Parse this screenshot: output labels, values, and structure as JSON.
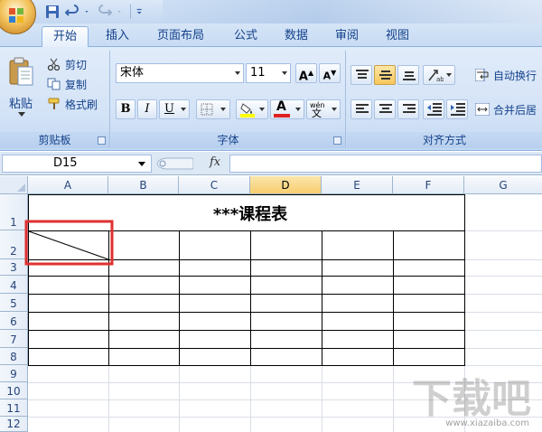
{
  "tabs": [
    "开始",
    "插入",
    "页面布局",
    "公式",
    "数据",
    "审阅",
    "视图"
  ],
  "active_tab": "开始",
  "clipboard": {
    "paste": "粘贴",
    "cut": "剪切",
    "copy": "复制",
    "format_painter": "格式刷",
    "group_label": "剪贴板"
  },
  "font": {
    "name": "宋体",
    "size": "11",
    "grow": "A",
    "shrink": "A",
    "bold": "B",
    "italic": "I",
    "underline": "U",
    "color_letter": "A",
    "pinyin": "wén",
    "pinyin_char": "文",
    "group_label": "字体"
  },
  "alignment": {
    "wrap_text": "自动换行",
    "merge_center": "合并后居",
    "group_label": "对齐方式"
  },
  "formula_bar": {
    "name_box": "D15",
    "fx": "fx",
    "value": ""
  },
  "columns": [
    "A",
    "B",
    "C",
    "D",
    "E",
    "F",
    "G"
  ],
  "selected_column": "D",
  "rows": [
    "1",
    "2",
    "3",
    "4",
    "5",
    "6",
    "7",
    "8",
    "9",
    "10",
    "11",
    "12"
  ],
  "sheet": {
    "title": "***课程表"
  },
  "watermark": {
    "brand": "下载吧",
    "url": "www.xiazaiba.com"
  },
  "colors": {
    "ribbon": "#d2e2f6",
    "accent_text": "#15428b",
    "selected_header": "#f7cd6e",
    "highlight_box": "#e03030",
    "font_color_bar": "#e02020",
    "fill_color_bar": "#ffff00"
  }
}
